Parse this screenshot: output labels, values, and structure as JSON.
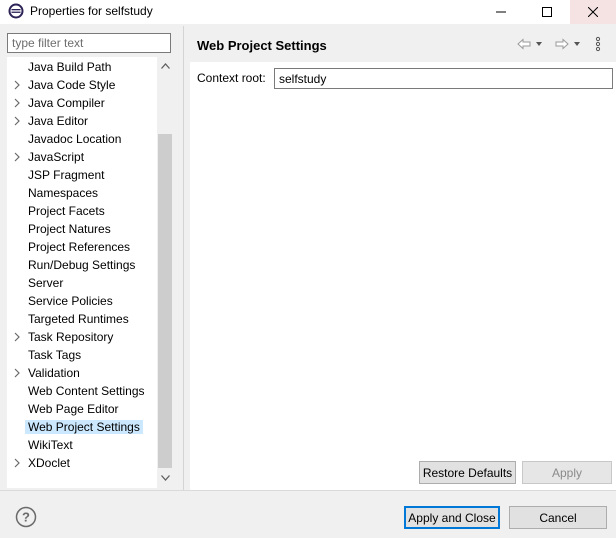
{
  "window": {
    "title": "Properties for selfstudy",
    "icons": [
      "app-icon",
      "minimize-icon",
      "maximize-icon",
      "close-icon"
    ]
  },
  "filter": {
    "placeholder": "type filter text",
    "value": ""
  },
  "tree": {
    "items": [
      {
        "label": "Java Build Path",
        "expandable": false
      },
      {
        "label": "Java Code Style",
        "expandable": true
      },
      {
        "label": "Java Compiler",
        "expandable": true
      },
      {
        "label": "Java Editor",
        "expandable": true
      },
      {
        "label": "Javadoc Location",
        "expandable": false
      },
      {
        "label": "JavaScript",
        "expandable": true
      },
      {
        "label": "JSP Fragment",
        "expandable": false
      },
      {
        "label": "Namespaces",
        "expandable": false
      },
      {
        "label": "Project Facets",
        "expandable": false
      },
      {
        "label": "Project Natures",
        "expandable": false
      },
      {
        "label": "Project References",
        "expandable": false
      },
      {
        "label": "Run/Debug Settings",
        "expandable": false
      },
      {
        "label": "Server",
        "expandable": false
      },
      {
        "label": "Service Policies",
        "expandable": false
      },
      {
        "label": "Targeted Runtimes",
        "expandable": false
      },
      {
        "label": "Task Repository",
        "expandable": true
      },
      {
        "label": "Task Tags",
        "expandable": false
      },
      {
        "label": "Validation",
        "expandable": true
      },
      {
        "label": "Web Content Settings",
        "expandable": false
      },
      {
        "label": "Web Page Editor",
        "expandable": false
      },
      {
        "label": "Web Project Settings",
        "expandable": false,
        "selected": true
      },
      {
        "label": "WikiText",
        "expandable": false
      },
      {
        "label": "XDoclet",
        "expandable": true
      }
    ],
    "selected_color": "#cce8ff"
  },
  "page": {
    "title": "Web Project Settings",
    "context_root_label": "Context root:",
    "context_root_value": "selfstudy",
    "restore_defaults_label": "Restore Defaults",
    "apply_label": "Apply",
    "nav_icons": [
      "back-arrow-icon",
      "back-dropdown-icon",
      "forward-arrow-icon",
      "forward-dropdown-icon",
      "view-menu-icon"
    ]
  },
  "footer": {
    "help_icon": "help-icon",
    "apply_and_close_label": "Apply and Close",
    "cancel_label": "Cancel",
    "accent_color": "#0078d7"
  }
}
